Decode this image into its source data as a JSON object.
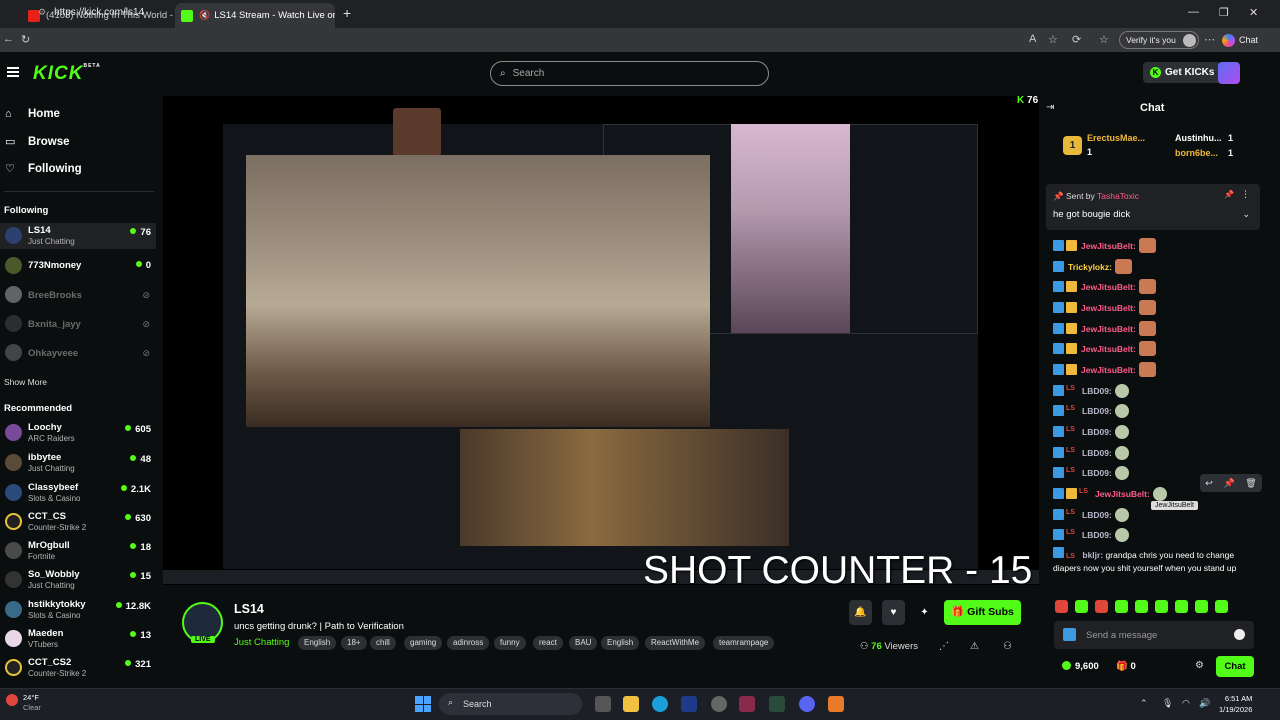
{
  "browser": {
    "tabs": [
      {
        "title": "(4103) Nothing In This World - You"
      },
      {
        "title": "LS14 Stream - Watch Live on"
      }
    ],
    "url": "https://kick.com/ls14",
    "verify_label": "Verify it's you",
    "chat_label": "Chat"
  },
  "header": {
    "logo": "KICK",
    "logo_badge": "BETA",
    "search_placeholder": "Search",
    "get_kicks": "Get KICKs"
  },
  "sidebar": {
    "nav": [
      {
        "label": "Home",
        "icon": "home-icon"
      },
      {
        "label": "Browse",
        "icon": "browse-icon"
      },
      {
        "label": "Following",
        "icon": "heart-icon"
      }
    ],
    "following_title": "Following",
    "following": [
      {
        "name": "LS14",
        "game": "Just Chatting",
        "viewers": "76",
        "live": true
      },
      {
        "name": "773Nmoney",
        "game": "",
        "viewers": "0",
        "live": true
      },
      {
        "name": "BreeBrooks",
        "live": false
      },
      {
        "name": "Bxnita_jayy",
        "live": false
      },
      {
        "name": "Ohkayveee",
        "live": false
      }
    ],
    "show_more": "Show More",
    "recommended_title": "Recommended",
    "recommended": [
      {
        "name": "Loochy",
        "game": "ARC Raiders",
        "viewers": "605"
      },
      {
        "name": "ibbytee",
        "game": "Just Chatting",
        "viewers": "48"
      },
      {
        "name": "Classybeef",
        "game": "Slots & Casino",
        "viewers": "2.1K"
      },
      {
        "name": "CCT_CS",
        "game": "Counter-Strike 2",
        "viewers": "630"
      },
      {
        "name": "MrOgbull",
        "game": "Fortnite",
        "viewers": "18"
      },
      {
        "name": "So_Wobbly",
        "game": "Just Chatting",
        "viewers": "15"
      },
      {
        "name": "hstikkytokky",
        "game": "Slots & Casino",
        "viewers": "12.8K"
      },
      {
        "name": "Maeden",
        "game": "VTubers",
        "viewers": "13"
      },
      {
        "name": "CCT_CS2",
        "game": "Counter-Strike 2",
        "viewers": "321"
      }
    ]
  },
  "player": {
    "viewer_count": "76",
    "overlay_text": "SHOT COUNTER - 15"
  },
  "stream": {
    "live_badge": "LIVE",
    "name": "LS14",
    "title": "uncs getting drunk? | Path to Verification",
    "category": "Just Chatting",
    "tags": [
      "English",
      "18+",
      "chill",
      "gaming",
      "adinross",
      "funny",
      "react",
      "BAU",
      "English",
      "ReactWithMe",
      "teamrampage"
    ],
    "gift_subs": "Gift Subs",
    "viewers_num": "76",
    "viewers_label": "Viewers"
  },
  "chat": {
    "title": "Chat",
    "gifters": [
      {
        "name": "ErectusMae...",
        "count": "1"
      },
      {
        "name": "Austinhu...",
        "count": "1"
      },
      {
        "name": "born6be...",
        "count": "1"
      }
    ],
    "pinned": {
      "sent_by_label": "Sent by",
      "sender": "TashaToxic",
      "message": "he got bougie dick"
    },
    "messages": [
      {
        "user": "JewJitsuBelt:",
        "color": "#ff5c8a",
        "badges": "bg",
        "emote": "face"
      },
      {
        "user": "Trickylokz:",
        "color": "#ffd23b",
        "badges": "b",
        "emote": "face"
      },
      {
        "user": "JewJitsuBelt:",
        "color": "#ff5c8a",
        "badges": "bg",
        "emote": "face"
      },
      {
        "user": "JewJitsuBelt:",
        "color": "#ff5c8a",
        "badges": "bg",
        "emote": "face"
      },
      {
        "user": "JewJitsuBelt:",
        "color": "#ff5c8a",
        "badges": "bg",
        "emote": "face"
      },
      {
        "user": "JewJitsuBelt:",
        "color": "#ff5c8a",
        "badges": "bg",
        "emote": "face"
      },
      {
        "user": "JewJitsuBelt:",
        "color": "#ff5c8a",
        "badges": "bg",
        "emote": "face"
      },
      {
        "user": "LBD09:",
        "color": "#b7b7c9",
        "badges": "br",
        "emote": "skull"
      },
      {
        "user": "LBD09:",
        "color": "#b7b7c9",
        "badges": "br",
        "emote": "skull"
      },
      {
        "user": "LBD09:",
        "color": "#b7b7c9",
        "badges": "br",
        "emote": "skull"
      },
      {
        "user": "LBD09:",
        "color": "#b7b7c9",
        "badges": "br",
        "emote": "skull"
      },
      {
        "user": "LBD09:",
        "color": "#b7b7c9",
        "badges": "br",
        "emote": "skull"
      },
      {
        "user": "JewJitsuBelt:",
        "color": "#ff5c8a",
        "badges": "bgr",
        "emote": "skull"
      },
      {
        "user": "LBD09:",
        "color": "#b7b7c9",
        "badges": "br",
        "emote": "skull"
      },
      {
        "user": "LBD09:",
        "color": "#b7b7c9",
        "badges": "br",
        "emote": "skull"
      }
    ],
    "tooltip": "JewJitsuBelt",
    "last_message": {
      "user": "bkljr:",
      "text": "grandpa chris you need to change diapers now you shit yourself when you stand up"
    },
    "input_placeholder": "Send a message",
    "points": "9,600",
    "gift_count": "0",
    "send_label": "Chat"
  },
  "taskbar": {
    "temp": "24°F",
    "weather": "Clear",
    "search": "Search",
    "time": "6:51 AM",
    "date": "1/19/2026"
  }
}
